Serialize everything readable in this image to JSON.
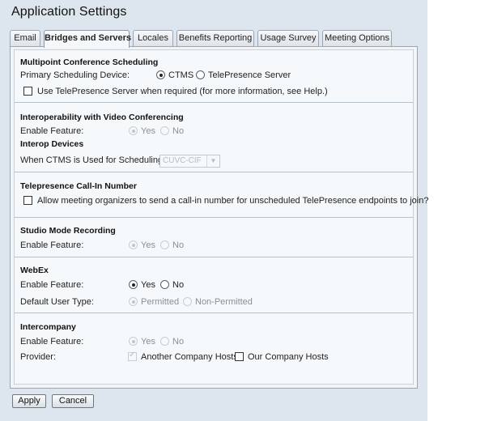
{
  "page_title": "Application Settings",
  "tabs": [
    {
      "label": "Email"
    },
    {
      "label": "Bridges and Servers"
    },
    {
      "label": "Locales"
    },
    {
      "label": "Benefits Reporting"
    },
    {
      "label": "Usage Survey"
    },
    {
      "label": "Meeting Options"
    }
  ],
  "active_tab": "Bridges and Servers",
  "multipoint": {
    "heading": "Multipoint Conference Scheduling",
    "device_label": "Primary Scheduling Device:",
    "option_ctms": "CTMS",
    "option_telepresence_server": "TelePresence Server",
    "selected": "CTMS",
    "use_ts_checkbox_label": "Use TelePresence Server when required (for more information, see Help.)",
    "use_ts_checked": false
  },
  "interop": {
    "heading": "Interoperability with Video Conferencing",
    "enable_label": "Enable Feature:",
    "yes": "Yes",
    "no": "No",
    "selected": "Yes",
    "devices_heading": "Interop Devices",
    "ctms_label": "When CTMS is Used for Scheduling:",
    "ctms_value": "CUVC-CIF"
  },
  "callin": {
    "heading": "Telepresence Call-In Number",
    "checkbox_label": "Allow meeting organizers to send a call-in number for unscheduled TelePresence endpoints to join?",
    "checked": false
  },
  "studio": {
    "heading": "Studio Mode Recording",
    "enable_label": "Enable Feature:",
    "yes": "Yes",
    "no": "No",
    "selected": "Yes"
  },
  "webex": {
    "heading": "WebEx",
    "enable_label": "Enable Feature:",
    "yes": "Yes",
    "no": "No",
    "selected": "Yes",
    "user_type_label": "Default User Type:",
    "permitted": "Permitted",
    "non_permitted": "Non-Permitted",
    "user_type_selected": "Permitted"
  },
  "intercompany": {
    "heading": "Intercompany",
    "enable_label": "Enable Feature:",
    "yes": "Yes",
    "no": "No",
    "selected": "Yes",
    "provider_label": "Provider:",
    "another_company": "Another Company Hosts",
    "another_checked": true,
    "our_company": "Our Company Hosts",
    "our_checked": false
  },
  "footer": {
    "apply_label": "Apply",
    "cancel_label": "Cancel"
  }
}
